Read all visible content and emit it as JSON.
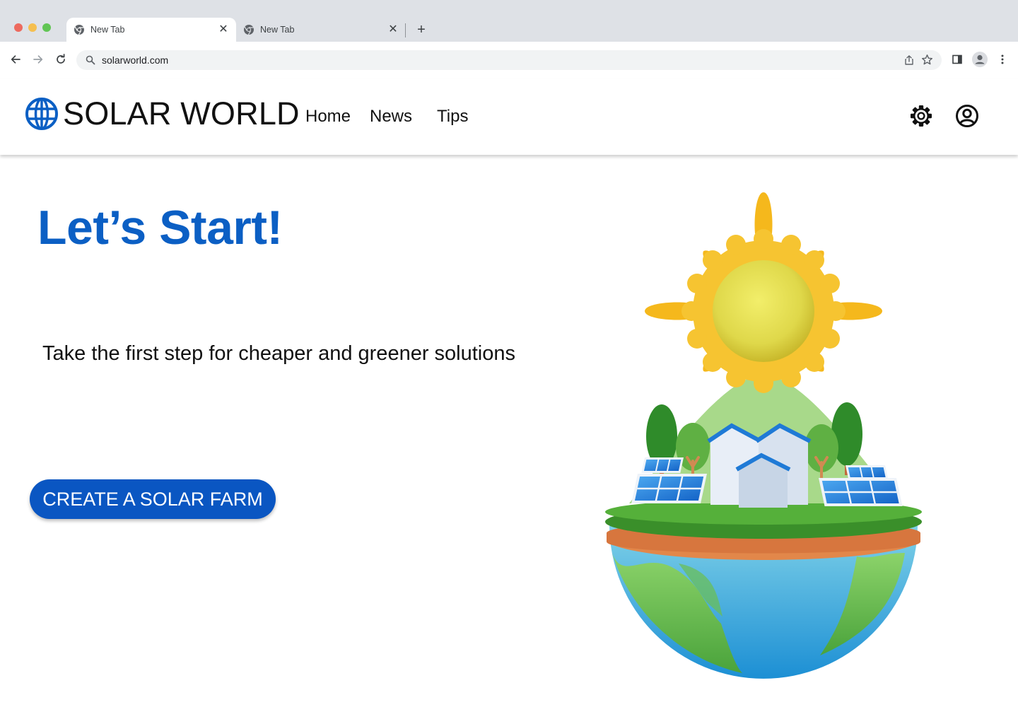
{
  "browser": {
    "tabs": [
      {
        "title": "New Tab",
        "active": true
      },
      {
        "title": "New Tab",
        "active": false
      }
    ],
    "new_tab_symbol": "+",
    "close_symbol": "✕",
    "url": "solarworld.com",
    "icons": [
      "back-arrow-icon",
      "forward-arrow-icon",
      "reload-icon",
      "search-icon",
      "share-icon",
      "star-icon",
      "side-panel-icon",
      "profile-icon",
      "kebab-menu-icon"
    ]
  },
  "header": {
    "brand": "SOLAR WORLD",
    "nav": {
      "home": "Home",
      "news": "News",
      "tips": "Tips"
    },
    "icons": [
      "globe-icon",
      "gear-icon",
      "account-icon"
    ]
  },
  "hero": {
    "title": "Let’s Start!",
    "subtitle": "Take the first step for cheaper and greener solutions",
    "cta_label": "CREATE A SOLAR FARM"
  },
  "colors": {
    "brand_blue": "#0b5fc4",
    "button_blue": "#0a56c2",
    "chrome_gray": "#dee1e6"
  }
}
